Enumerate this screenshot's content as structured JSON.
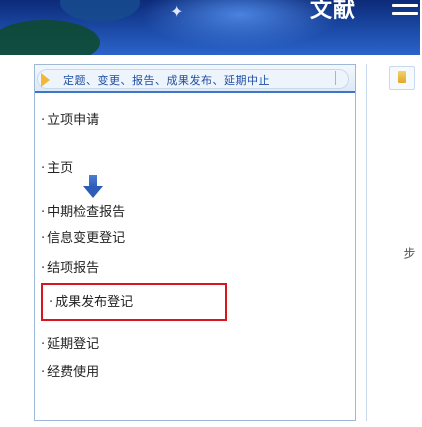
{
  "banner": {
    "brand": "文献",
    "star": "✦"
  },
  "tabs": {
    "label": "定题、变更、报告、成果发布、延期中止"
  },
  "nav": {
    "items": [
      {
        "label": "立项申请"
      },
      {
        "label": "主页"
      },
      {
        "label": "中期检查报告"
      },
      {
        "label": "信息变更登记"
      },
      {
        "label": "结项报告"
      },
      {
        "label": "成果发布登记"
      },
      {
        "label": "延期登记"
      },
      {
        "label": "经费使用"
      }
    ],
    "bullet": "·"
  },
  "right": {
    "side_text": "步"
  }
}
